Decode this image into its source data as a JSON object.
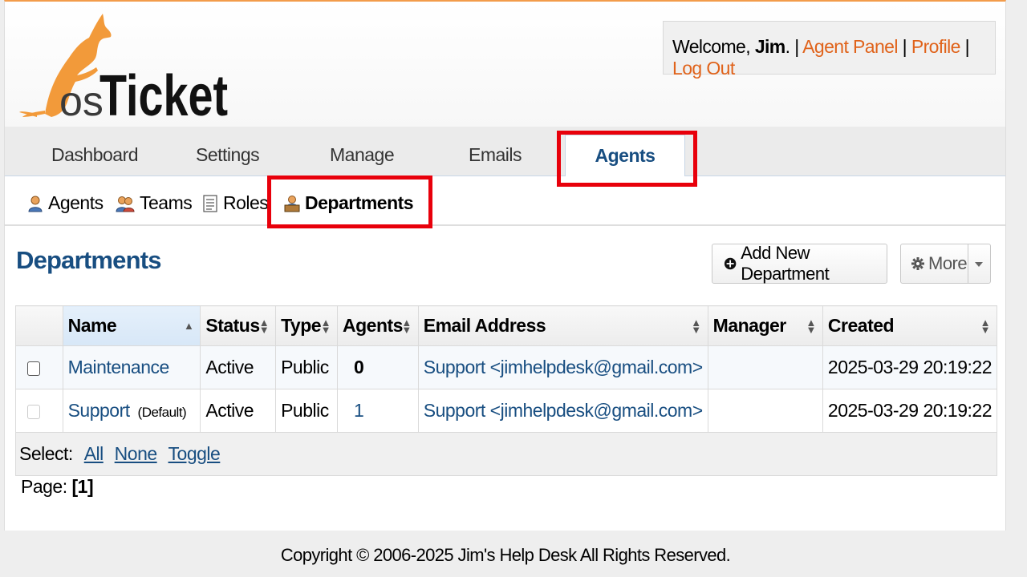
{
  "brand": {
    "logo_text": "osTicket",
    "accent": "#e0631b",
    "primary": "#184e81"
  },
  "user_info": {
    "welcome_prefix": "Welcome, ",
    "username": "Jim",
    "suffix": ". | ",
    "links": [
      "Agent Panel",
      "Profile",
      "Log Out"
    ],
    "separator": " | "
  },
  "nav": {
    "tabs": [
      "Dashboard",
      "Settings",
      "Manage",
      "Emails",
      "Agents"
    ],
    "active": "Agents"
  },
  "subnav": {
    "items": [
      "Agents",
      "Teams",
      "Roles",
      "Departments"
    ],
    "active": "Departments"
  },
  "page": {
    "title": "Departments",
    "add_button": "Add New Department",
    "more_button": "More"
  },
  "table": {
    "headers": [
      "Name",
      "Status",
      "Type",
      "Agents",
      "Email Address",
      "Manager",
      "Created"
    ],
    "rows": [
      {
        "name": "Maintenance",
        "default": "",
        "status": "Active",
        "type": "Public",
        "agents": "0",
        "email": "Support <jimhelpdesk@gmail.com>",
        "manager": "",
        "created": "2025-03-29 20:19:22"
      },
      {
        "name": "Support",
        "default": "(Default)",
        "status": "Active",
        "type": "Public",
        "agents": "1",
        "email": "Support <jimhelpdesk@gmail.com>",
        "manager": "",
        "created": "2025-03-29 20:19:22"
      }
    ],
    "select_label": "Select:",
    "select_links": [
      "All",
      "None",
      "Toggle"
    ]
  },
  "pager": {
    "label": "Page:",
    "current": "[1]"
  },
  "footer": {
    "text": "Copyright © 2006-2025 Jim's Help Desk All Rights Reserved."
  }
}
